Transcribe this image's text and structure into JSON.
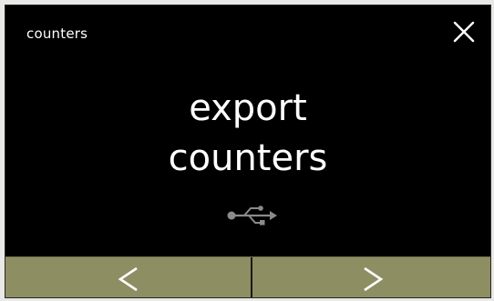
{
  "header": {
    "title": "counters",
    "close_icon": "close-icon"
  },
  "main": {
    "label_line1": "export",
    "label_line2": "counters",
    "icon": "usb-icon"
  },
  "nav": {
    "prev_icon": "chevron-left-icon",
    "next_icon": "chevron-right-icon"
  },
  "colors": {
    "screen_bg": "#000000",
    "text": "#ffffff",
    "nav_bar_bg": "#8e8e63",
    "icon_gray": "#8a8a8a"
  }
}
